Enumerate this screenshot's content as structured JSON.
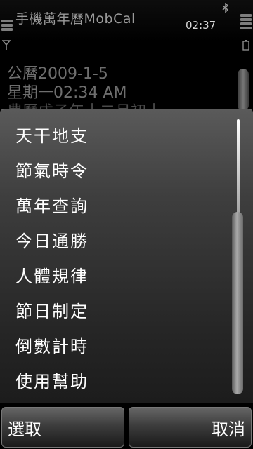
{
  "status": {
    "app_title": "手機萬年曆MobCal",
    "time": "02:37"
  },
  "background": {
    "date_line": "公曆2009-1-5",
    "weekday_time": "星期一02:34 AM",
    "partial_line": "農曆戊子年十二月初十"
  },
  "menu": {
    "items": [
      "天干地支",
      "節氣時令",
      "萬年查詢",
      "今日通勝",
      "人體規律",
      "節日制定",
      "倒數計時",
      "使用幫助"
    ]
  },
  "softkeys": {
    "left": "選取",
    "right": "取消"
  },
  "icons": {
    "bluetooth": "bluetooth-icon",
    "signal": "signal-strength-icon",
    "battery": "battery-level-icon"
  }
}
